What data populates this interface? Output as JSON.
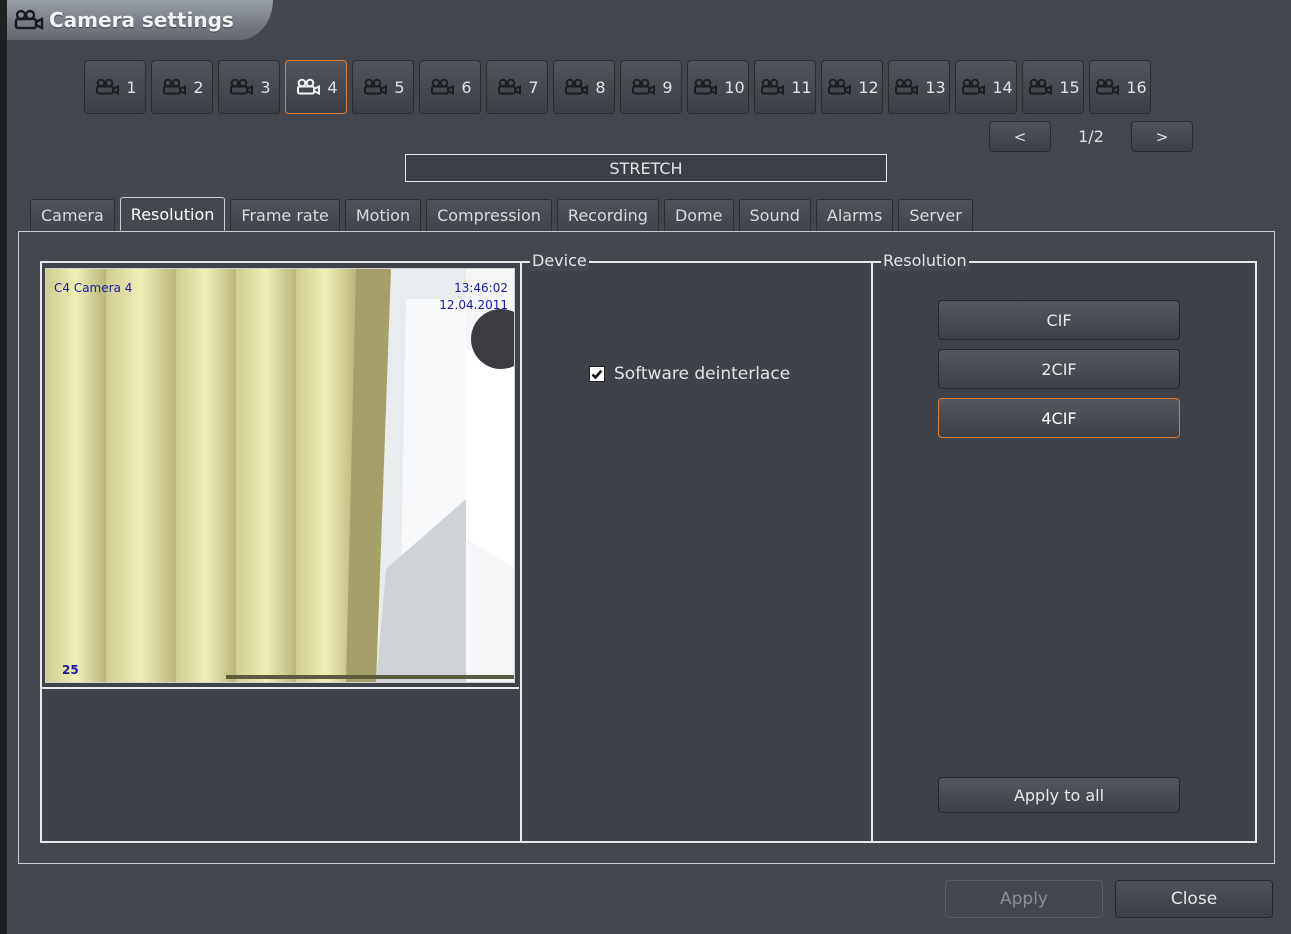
{
  "window": {
    "title": "Camera settings",
    "title_icon": "camera-group-icon"
  },
  "camera_buttons": [
    {
      "label": "1"
    },
    {
      "label": "2"
    },
    {
      "label": "3"
    },
    {
      "label": "4",
      "selected": true
    },
    {
      "label": "5"
    },
    {
      "label": "6"
    },
    {
      "label": "7"
    },
    {
      "label": "8"
    },
    {
      "label": "9"
    },
    {
      "label": "10"
    },
    {
      "label": "11"
    },
    {
      "label": "12"
    },
    {
      "label": "13"
    },
    {
      "label": "14"
    },
    {
      "label": "15"
    },
    {
      "label": "16"
    }
  ],
  "pager": {
    "prev_label": "<",
    "page_label": "1/2",
    "next_label": ">"
  },
  "stretch_label": "STRETCH",
  "tabs": [
    {
      "label": "Camera"
    },
    {
      "label": "Resolution",
      "active": true
    },
    {
      "label": "Frame rate"
    },
    {
      "label": "Motion"
    },
    {
      "label": "Compression"
    },
    {
      "label": "Recording"
    },
    {
      "label": "Dome"
    },
    {
      "label": "Sound"
    },
    {
      "label": "Alarms"
    },
    {
      "label": "Server"
    }
  ],
  "preview": {
    "camera_name": "C4 Camera 4",
    "time": "13:46:02",
    "date": "12.04.2011",
    "fps": "25"
  },
  "device_group": {
    "label": "Device",
    "software_deinterlace": {
      "label": "Software deinterlace",
      "checked": true
    }
  },
  "resolution_group": {
    "label": "Resolution",
    "options": [
      {
        "label": "CIF"
      },
      {
        "label": "2CIF"
      },
      {
        "label": "4CIF",
        "selected": true
      }
    ],
    "apply_all_label": "Apply to all"
  },
  "footer": {
    "apply_label": "Apply",
    "close_label": "Close"
  },
  "colors": {
    "background": "#44474e",
    "accent_selected": "#e07a30",
    "osd_text": "#1a1aa8"
  }
}
